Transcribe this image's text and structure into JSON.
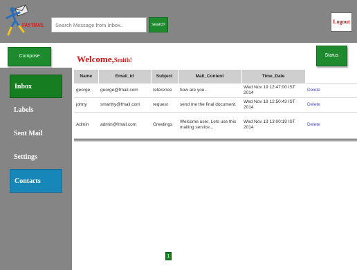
{
  "header": {
    "logo_text": "FASTMAIL",
    "search_placeholder": "Search Message from Inbox..",
    "search_label": "search",
    "logout_label": "Logout"
  },
  "toolbar": {
    "compose_label": "Compose",
    "welcome_prefix": "Welcome,",
    "welcome_name": "Smith!",
    "status_label": "Status"
  },
  "sidebar": {
    "items": [
      {
        "label": "Inbox"
      },
      {
        "label": "Labels"
      },
      {
        "label": "Sent Mail"
      },
      {
        "label": "Settings"
      },
      {
        "label": "Contacts"
      }
    ]
  },
  "table": {
    "headers": [
      "Name",
      "Email_id",
      "Subject",
      "Mail_Content",
      "Time_Date"
    ],
    "rows": [
      {
        "name": "george",
        "email": "george@fmail.com",
        "subject": "reference",
        "content": "how are you..",
        "time": "Wed Nov 19 12:47:00 IST 2014",
        "action": "Delete"
      },
      {
        "name": "johny",
        "email": "smarthy@fmail.com",
        "subject": "request",
        "content": "send me the final document.",
        "time": "Wed Nov 19 12:50:43 IST 2014",
        "action": "Delete"
      },
      {
        "name": "Admin",
        "email": "admin@fmail.com",
        "subject": "Greetings",
        "content": "Welcome user, Lets use this mailing service...",
        "time": "Wed Nov 19 13:00:19 IST 2014",
        "action": "Delete"
      }
    ]
  },
  "pager": {
    "current": "1"
  },
  "colors": {
    "accent_green": "#1e8a2e",
    "accent_blue": "#1787b9",
    "logout_red": "#d21717",
    "chrome_gray": "#858585"
  }
}
